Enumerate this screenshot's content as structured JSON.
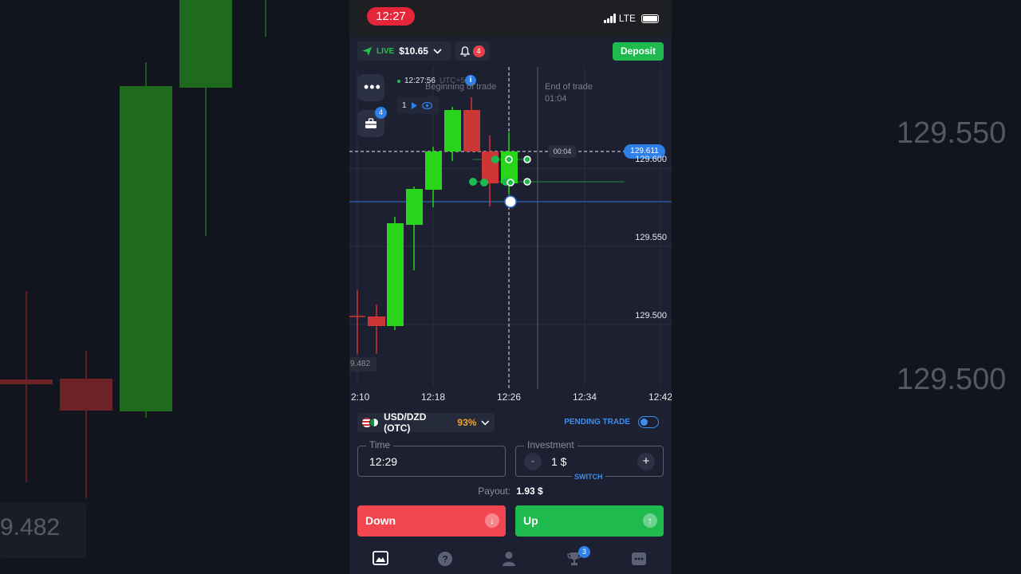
{
  "status_bar": {
    "time": "12:27",
    "network": "LTE"
  },
  "account": {
    "mode": "LIVE",
    "balance": "$10.65",
    "notifications": "4"
  },
  "deposit_label": "Deposit",
  "chart": {
    "server_time": "12:27:56",
    "utc": "UTC+5",
    "beginning_label": "Beginning of trade",
    "end_label": "End of trade",
    "end_time": "01:04",
    "timer": "00:04",
    "current_price": "129.611",
    "price_ticks": [
      "129.600",
      "129.550",
      "129.500"
    ],
    "time_ticks": [
      "2:10",
      "12:18",
      "12:26",
      "12:34",
      "12:42"
    ],
    "left_price": "9.482",
    "trades_count": "1",
    "portfolio_badge": "4"
  },
  "pair": {
    "name": "USD/DZD (OTC)",
    "payout_pct": "93%"
  },
  "pending_trade_label": "PENDING TRADE",
  "time_field": {
    "label": "Time",
    "value": "12:29"
  },
  "investment_field": {
    "label": "Investment",
    "value": "1 $",
    "minus": "-",
    "plus": "+",
    "switch": "SWITCH"
  },
  "payout": {
    "label": "Payout:",
    "value": "1.93 $"
  },
  "buttons": {
    "down": "Down",
    "up": "Up"
  },
  "nav": {
    "trophy_badge": "3"
  },
  "background": {
    "price_a": "129.550",
    "price_b": "129.500",
    "price_c": "9.482"
  },
  "colors": {
    "up": "#2ad41a",
    "down": "#cc3636",
    "accent": "#2f7fe8",
    "deposit": "#1fba4e"
  }
}
